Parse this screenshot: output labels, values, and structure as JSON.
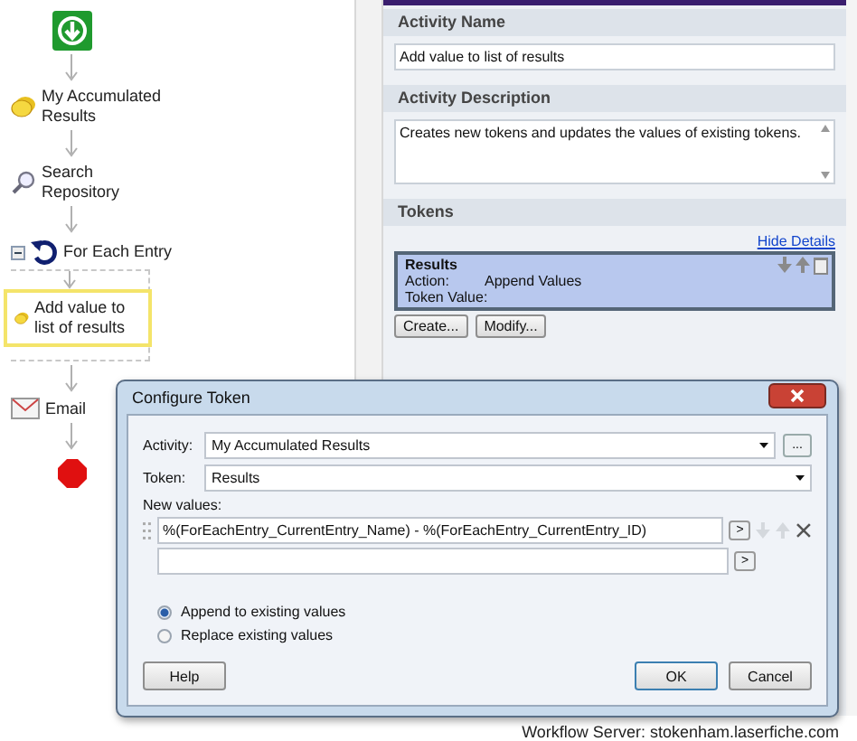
{
  "flow": {
    "nodes": [
      {
        "kind": "start"
      },
      {
        "kind": "token",
        "label": "My Accumulated Results",
        "selected": false
      },
      {
        "kind": "search",
        "label": "Search Repository",
        "selected": false
      },
      {
        "kind": "loop",
        "label": "For Each Entry",
        "expanded": true,
        "selected": false,
        "children": [
          {
            "kind": "token",
            "label": "Add value to list of results",
            "selected": true
          }
        ]
      },
      {
        "kind": "email",
        "label": "Email",
        "selected": false
      },
      {
        "kind": "stop"
      }
    ]
  },
  "properties": {
    "sections": [
      {
        "kind": "field",
        "title": "Activity Name",
        "value": "Add value to list of results"
      },
      {
        "kind": "textarea",
        "title": "Activity Description",
        "value": "Creates new tokens and updates the values of existing tokens."
      },
      {
        "kind": "tokens",
        "title": "Tokens",
        "link": "Hide Details",
        "tokens": [
          {
            "name": "Results",
            "action_label": "Action:",
            "action": "Append Values",
            "value_label": "Token Value:",
            "selected": true
          }
        ],
        "buttons": [
          "Create...",
          "Modify..."
        ]
      }
    ]
  },
  "dialog": {
    "title": "Configure Token",
    "activity_label": "Activity:",
    "activity": "My Accumulated Results",
    "browse_button": "...",
    "token_label": "Token:",
    "token": "Results",
    "values_label": "New values:",
    "insert_button": ">",
    "values": [
      "%(ForEachEntry_CurrentEntry_Name) - %(ForEachEntry_CurrentEntry_ID)"
    ],
    "options": [
      {
        "label": "Append to existing values",
        "selected": true
      },
      {
        "label": "Replace existing values",
        "selected": false
      }
    ],
    "buttons": [
      {
        "label": "Help",
        "kind": "help"
      },
      {
        "label": "OK",
        "kind": "default"
      },
      {
        "label": "Cancel",
        "kind": "cancel"
      }
    ]
  },
  "status_bar": {
    "text": "Workflow Server: stokenham.laserfiche.com"
  }
}
